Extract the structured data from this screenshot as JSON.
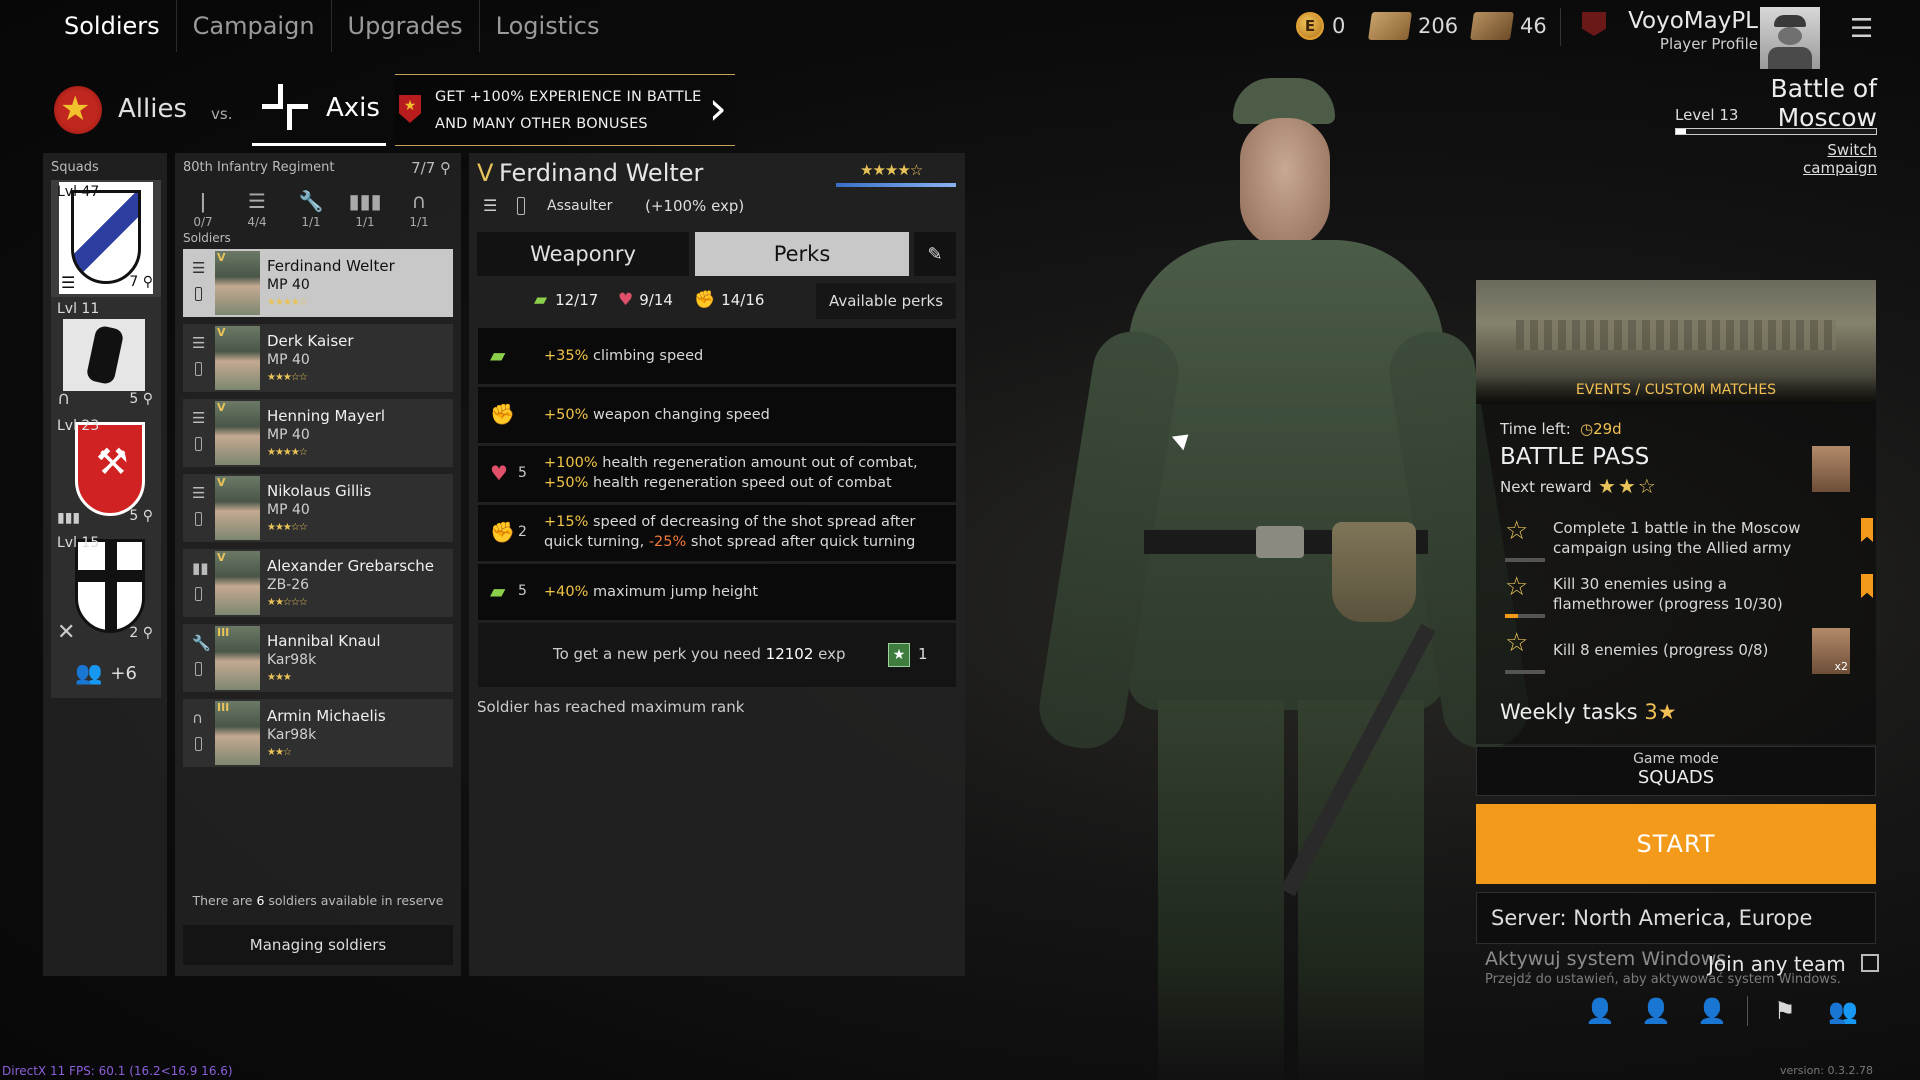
{
  "nav": {
    "tabs": [
      "Soldiers",
      "Campaign",
      "Upgrades",
      "Logistics"
    ],
    "active": "Soldiers"
  },
  "currency": {
    "gold": "0",
    "gold_symbol": "E",
    "tickets_a": "206",
    "tickets_b": "46"
  },
  "profile": {
    "name": "VoyoMayPL",
    "subtitle": "Player Profile"
  },
  "campaign": {
    "title": "Battle of Moscow",
    "level": "Level 13",
    "level_progress": 0.05,
    "switch_label": "Switch campaign"
  },
  "factions": {
    "allies": "Allies",
    "vs": "vs.",
    "axis": "Axis"
  },
  "promo": {
    "line1": "GET +100% EXPERIENCE IN BATTLE",
    "line2": "AND MANY OTHER BONUSES",
    "arrow": "›"
  },
  "squads": {
    "title": "Squads",
    "items": [
      {
        "level": "Lvl 47",
        "count": "7"
      },
      {
        "level": "Lvl 11",
        "count": "5"
      },
      {
        "level": "Lvl 23",
        "count": "5"
      },
      {
        "level": "Lvl 15",
        "count": "2"
      }
    ],
    "extra": "+6"
  },
  "regiment": {
    "name": "80th Infantry Regiment",
    "count": "7/7",
    "slots": [
      "0/7",
      "4/4",
      "1/1",
      "1/1",
      "1/1"
    ],
    "soldiers_label": "Soldiers",
    "reserve_prefix": "There are ",
    "reserve_count": "6",
    "reserve_suffix": " soldiers available in reserve",
    "manage_label": "Managing soldiers"
  },
  "soldiers": [
    {
      "rank": "V",
      "name": "Ferdinand Welter",
      "weapon": "MP 40",
      "stars": "★★★★☆"
    },
    {
      "rank": "V",
      "name": "Derk Kaiser",
      "weapon": "MP 40",
      "stars": "★★★☆☆"
    },
    {
      "rank": "V",
      "name": "Henning Mayerl",
      "weapon": "MP 40",
      "stars": "★★★★☆"
    },
    {
      "rank": "V",
      "name": "Nikolaus Gillis",
      "weapon": "MP 40",
      "stars": "★★★☆☆"
    },
    {
      "rank": "V",
      "name": "Alexander Grebarsche",
      "weapon": "ZB-26",
      "stars": "★★☆☆☆"
    },
    {
      "rank": "III",
      "name": "Hannibal Knaul",
      "weapon": "Kar98k",
      "stars": "★★★"
    },
    {
      "rank": "III",
      "name": "Armin Michaelis",
      "weapon": "Kar98k",
      "stars": "★★☆"
    }
  ],
  "detail": {
    "rank": "V",
    "name": "Ferdinand Welter",
    "class": "Assaulter",
    "bonus": "(+100% exp)",
    "stars": "★★★★☆",
    "tab_weaponry": "Weaponry",
    "tab_perks": "Perks",
    "stat_agility": "12/17",
    "stat_vitality": "9/14",
    "stat_strength": "14/16",
    "available_perks": "Available perks",
    "perks": [
      {
        "level": "",
        "highlight": "+35%",
        "text": " climbing speed"
      },
      {
        "level": "",
        "highlight": "+50%",
        "text": " weapon changing speed"
      },
      {
        "level": "5",
        "highlight": "+100%",
        "text": " health regeneration amount out of combat, ",
        "highlight2": "+50%",
        "text2": " health regeneration speed out of combat"
      },
      {
        "level": "2",
        "highlight": "+15%",
        "text": " speed of decreasing of the shot spread after quick turning, ",
        "highlight2": "-25%",
        "text2": " shot spread after quick turning"
      },
      {
        "level": "5",
        "highlight": "+40%",
        "text": " maximum jump height"
      }
    ],
    "new_perk_prefix": "To get a new perk you need ",
    "new_perk_exp": "12102",
    "new_perk_suffix": " exp",
    "perk_points": "1",
    "max_rank": "Soldier has reached maximum rank"
  },
  "events": {
    "label": "EVENTS / CUSTOM MATCHES"
  },
  "battle_pass": {
    "time_left_label": "Time left:",
    "time_left": "29d",
    "title": "BATTLE PASS",
    "next_reward": "Next reward",
    "tasks": [
      {
        "text": "Complete 1 battle in the Moscow campaign using the Allied army",
        "progress": 0
      },
      {
        "text": "Kill 30 enemies using a flamethrower (progress 10/30)",
        "progress": 0.33
      },
      {
        "text": "Kill 8 enemies (progress 0/8)",
        "progress": 0,
        "reward_mult": "x2"
      }
    ],
    "weekly_label": "Weekly tasks",
    "weekly_count": "3"
  },
  "game": {
    "mode_label": "Game mode",
    "mode": "SQUADS",
    "start": "START",
    "server": "Server: North America, Europe",
    "join_any": "Join any team"
  },
  "watermark": {
    "line1": "Aktywuj system Windows",
    "line2": "Przejdź do ustawień, aby aktywować system Windows."
  },
  "debug": {
    "fps": "DirectX 11 FPS: 60.1 (16.2<16.9 16.6)",
    "version": "version: 0.3.2.78"
  },
  "colors": {
    "accent": "#f39a1a",
    "gold": "#e8c35a",
    "perk_highlight": "#f0c446"
  }
}
